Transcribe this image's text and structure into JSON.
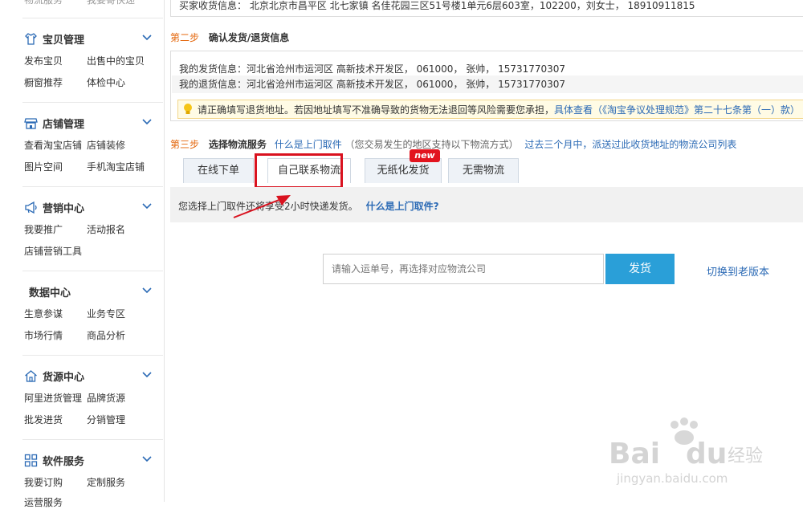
{
  "sidebar": {
    "top_partial": [
      "物流服务",
      "我要寄快递"
    ],
    "sections": [
      {
        "title": "宝贝管理",
        "icon": "shirt-icon",
        "links": [
          "发布宝贝",
          "出售中的宝贝",
          "橱窗推荐",
          "体检中心"
        ]
      },
      {
        "title": "店铺管理",
        "icon": "shop-icon",
        "links": [
          "查看淘宝店铺",
          "店铺装修",
          "图片空间",
          "手机淘宝店铺"
        ]
      },
      {
        "title": "营销中心",
        "icon": "megaphone-icon",
        "links": [
          "我要推广",
          "活动报名",
          "店铺营销工具"
        ]
      },
      {
        "title": "数据中心",
        "icon": "",
        "links": [
          "生意参谋",
          "业务专区",
          "市场行情",
          "商品分析"
        ]
      },
      {
        "title": "货源中心",
        "icon": "house-icon",
        "links": [
          "阿里进货管理",
          "品牌货源",
          "批发进货",
          "分销管理"
        ]
      },
      {
        "title": "软件服务",
        "icon": "grid-icon",
        "links": [
          "我要订购",
          "定制服务",
          "运营服务"
        ]
      }
    ]
  },
  "buyer_address": "买家收货信息： 北京北京市昌平区 北七家镇 名佳花园三区51号楼1单元6层603室，102200，刘女士， 18910911815",
  "step2": {
    "num": "第二步",
    "title": "确认发货/退货信息",
    "ship_from": "我的发货信息：河北省沧州市运河区 高新技术开发区， 061000， 张帅，  15731770307",
    "return_to": "我的退货信息：河北省沧州市运河区 高新技术开发区， 061000， 张帅，  15731770307",
    "notice_text": "请正确填写退货地址。若因地址填写不准确导致的货物无法退回等风险需要您承担，",
    "notice_link": "具体查看（《淘宝争议处理规范》第二十七条第（一）款）"
  },
  "step3": {
    "num": "第三步",
    "title": "选择物流服务",
    "what_pickup": "什么是上门取件",
    "hint": "（您交易发生的地区支持以下物流方式）",
    "history_link": "过去三个月中，派送过此收货地址的物流公司列表"
  },
  "tabs": [
    "在线下单",
    "自己联系物流",
    "无纸化发货",
    "无需物流"
  ],
  "active_tab": 1,
  "new_badge": "new",
  "info_strip": {
    "text": "您选择上门取件还将享受2小时快递发货。",
    "link": "什么是上门取件?"
  },
  "tracking_input": {
    "placeholder": "请输入运单号，再选择对应物流公司",
    "value": ""
  },
  "ship_button": "发货",
  "switch_link": "切换到老版本",
  "colors": {
    "accent_blue": "#2a9fd8",
    "highlight_red": "#d9121f",
    "link_blue": "#2b6ab5",
    "step_orange": "#e4670c"
  }
}
